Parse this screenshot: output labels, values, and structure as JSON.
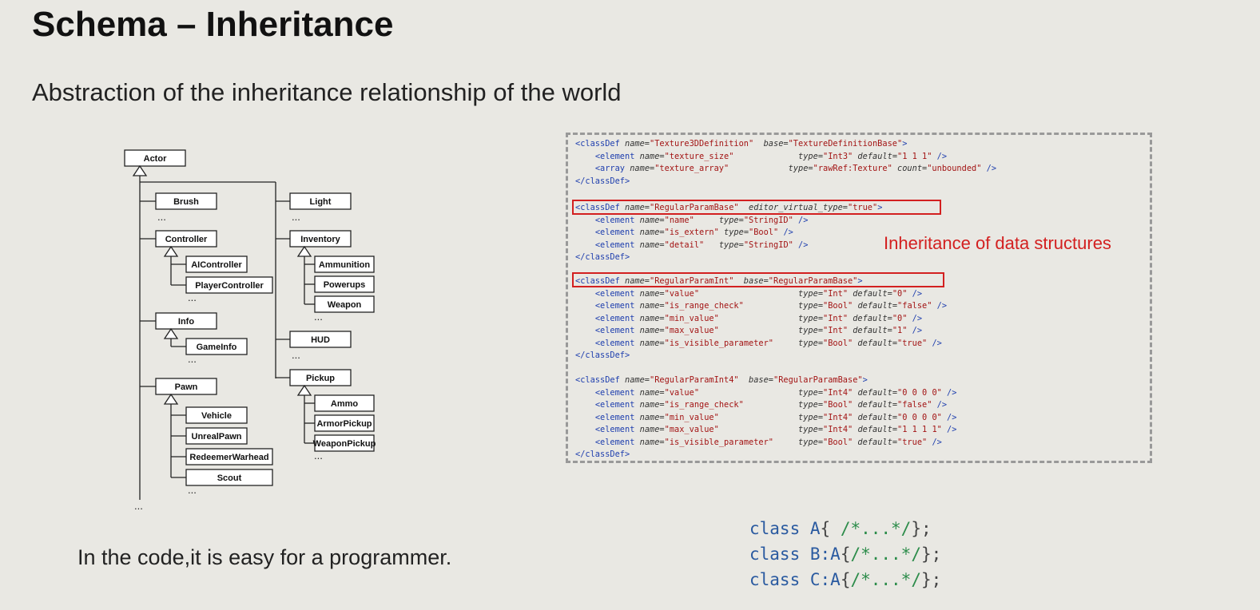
{
  "slide": {
    "title": "Schema – Inheritance",
    "subtitle": "Abstraction of the inheritance relationship of the world",
    "note": "In the code,it is easy for a programmer.",
    "callout": "Inheritance of data structures",
    "colors": {
      "callout": "#d32020",
      "code_tag": "#1f3fae",
      "code_value": "#a31515",
      "cpp_keyword": "#2a5aa0",
      "cpp_comment": "#2c8c4a"
    }
  },
  "tree": {
    "root": "Actor",
    "ellipsis": "...",
    "left_children": [
      {
        "label": "Brush",
        "children": []
      },
      {
        "label": "Controller",
        "children": [
          "AIController",
          "PlayerController"
        ]
      },
      {
        "label": "Info",
        "children": [
          "GameInfo"
        ]
      },
      {
        "label": "Pawn",
        "children": [
          "Vehicle",
          "UnrealPawn",
          "RedeemerWarhead",
          "Scout"
        ]
      }
    ],
    "right_children": [
      {
        "label": "Light",
        "children": []
      },
      {
        "label": "Inventory",
        "children": [
          "Ammunition",
          "Powerups",
          "Weapon"
        ]
      },
      {
        "label": "HUD",
        "children": []
      },
      {
        "label": "Pickup",
        "children": [
          "Ammo",
          "ArmorPickup",
          "WeaponPickup"
        ]
      }
    ]
  },
  "xml": {
    "blocks": [
      {
        "name": "Texture3DDefinition",
        "attr_key": "base",
        "attr_val": "TextureDefinitionBase",
        "elements": [
          {
            "tag": "element",
            "name": "texture_size",
            "type": "Int3",
            "default": "1 1 1"
          },
          {
            "tag": "array",
            "name": "texture_array",
            "type": "rawRef:Texture",
            "count": "unbounded"
          }
        ]
      },
      {
        "name": "RegularParamBase",
        "attr_key": "editor_virtual_type",
        "attr_val": "true",
        "elements": [
          {
            "tag": "element",
            "name": "name",
            "type": "StringID"
          },
          {
            "tag": "element",
            "name": "is_extern",
            "type": "Bool"
          },
          {
            "tag": "element",
            "name": "detail",
            "type": "StringID"
          }
        ]
      },
      {
        "name": "RegularParamInt",
        "attr_key": "base",
        "attr_val": "RegularParamBase",
        "elements": [
          {
            "tag": "element",
            "name": "value",
            "type": "Int",
            "default": "0"
          },
          {
            "tag": "element",
            "name": "is_range_check",
            "type": "Bool",
            "default": "false"
          },
          {
            "tag": "element",
            "name": "min_value",
            "type": "Int",
            "default": "0"
          },
          {
            "tag": "element",
            "name": "max_value",
            "type": "Int",
            "default": "1"
          },
          {
            "tag": "element",
            "name": "is_visible_parameter",
            "type": "Bool",
            "default": "true"
          }
        ]
      },
      {
        "name": "RegularParamInt4",
        "attr_key": "base",
        "attr_val": "RegularParamBase",
        "elements": [
          {
            "tag": "element",
            "name": "value",
            "type": "Int4",
            "default": "0 0 0 0"
          },
          {
            "tag": "element",
            "name": "is_range_check",
            "type": "Bool",
            "default": "false"
          },
          {
            "tag": "element",
            "name": "min_value",
            "type": "Int4",
            "default": "0 0 0 0"
          },
          {
            "tag": "element",
            "name": "max_value",
            "type": "Int4",
            "default": "1 1 1 1"
          },
          {
            "tag": "element",
            "name": "is_visible_parameter",
            "type": "Bool",
            "default": "true"
          }
        ]
      }
    ]
  },
  "cpp": {
    "lines": [
      {
        "keyword": "class",
        "name": "A",
        "body": "{ /*...*/};"
      },
      {
        "keyword": "class",
        "name": "B:A",
        "body": "{/*...*/};"
      },
      {
        "keyword": "class",
        "name": "C:A",
        "body": "{/*...*/};"
      }
    ]
  }
}
